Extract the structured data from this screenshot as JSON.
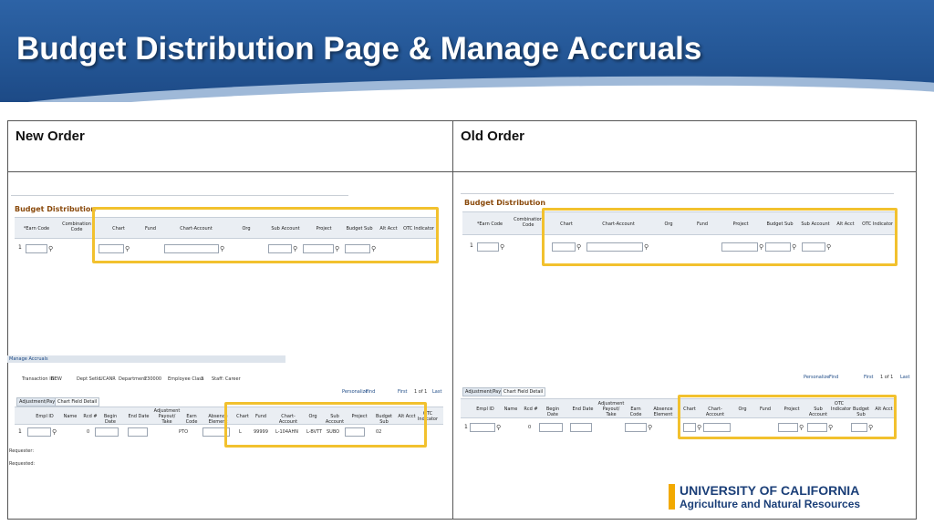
{
  "slide": {
    "title": "Budget Distribution Page & Manage Accruals"
  },
  "table": {
    "left_header": "New Order",
    "right_header": "Old Order"
  },
  "new_order": {
    "budget_title": "Budget Distribution",
    "budget_columns": [
      "*Earn Code",
      "Combination Code",
      "Chart",
      "Fund",
      "Chart-Account",
      "Org",
      "Sub Account",
      "Project",
      "Budget Sub",
      "Alt Acct",
      "OTC Indicator"
    ],
    "budget_row_num": "1",
    "accrual_section": "Manage Accruals",
    "info": {
      "transaction_label": "Transaction ID",
      "transaction_value": "NEW",
      "dept_setid_label": "Dept SetId",
      "dept_setid_value": "UCANR",
      "department_label": "Department",
      "department_value": "230000",
      "employee_class_label": "Employee Class",
      "employee_class_value": "3",
      "employee_class_desc": "Staff: Career"
    },
    "nav": {
      "personalize": "Personalize",
      "find": "Find",
      "first": "First",
      "count": "1 of 1",
      "last": "Last"
    },
    "tabs": [
      "Adjustment/Payout",
      "Chart Field Detail"
    ],
    "accrual_columns": [
      "Empl ID",
      "Name",
      "Rcd #",
      "Begin Date",
      "End Date",
      "Adjustment Payout/ Take",
      "Earn Code",
      "Absence Element",
      "Chart",
      "Fund",
      "Chart-Account",
      "Org",
      "Sub Account",
      "Project",
      "Budget Sub",
      "Alt Acct",
      "OTC Indicator"
    ],
    "accrual_row": {
      "rownum": "1",
      "rcd": "0",
      "earn_code": "PTO",
      "chart": "L",
      "fund": "99999",
      "chart_account": "L-104AHN",
      "org": "L-BVTT",
      "sub_account": "SUBO",
      "budget_sub": "02"
    },
    "requester_label": "Requester:",
    "requested_label": "Requested:"
  },
  "old_order": {
    "budget_title": "Budget Distribution",
    "budget_columns": [
      "*Earn Code",
      "Combination Code",
      "Chart",
      "Chart-Account",
      "Org",
      "Fund",
      "Project",
      "Budget Sub",
      "Sub Account",
      "Alt Acct",
      "OTC Indicator"
    ],
    "budget_row_num": "1",
    "nav": {
      "personalize": "Personalize",
      "find": "Find",
      "first": "First",
      "count": "1 of 1",
      "last": "Last"
    },
    "tabs": [
      "Adjustment/Payout",
      "Chart Field Detail"
    ],
    "accrual_columns": [
      "Empl ID",
      "Name",
      "Rcd #",
      "Begin Date",
      "End Date",
      "Adjustment Payout/ Take",
      "Earn Code",
      "Absence Element",
      "Chart",
      "Chart-Account",
      "Org",
      "Fund",
      "Project",
      "Sub Account",
      "OTC Indicator",
      "Budget Sub",
      "Alt Acct"
    ],
    "accrual_row": {
      "rownum": "1",
      "rcd": "0"
    }
  },
  "logo": {
    "line1": "UNIVERSITY OF CALIFORNIA",
    "line2": "Agriculture and Natural Resources"
  },
  "icons": {
    "lookup": "magnifier-icon",
    "calendar": "calendar-icon"
  },
  "colors": {
    "banner": "#235594",
    "highlight": "#f2c12e",
    "logo_navy": "#1b3f78",
    "logo_gold": "#f2a900"
  }
}
